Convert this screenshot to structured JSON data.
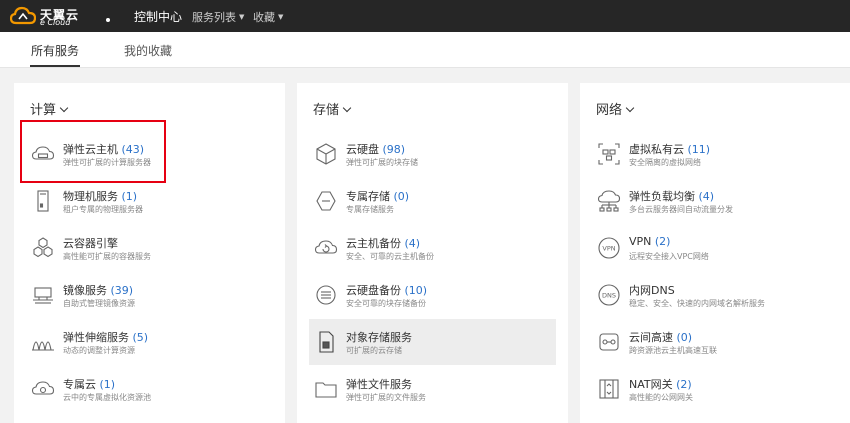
{
  "brand": {
    "name_cn": "天翼云",
    "name_en": "e Cloud"
  },
  "nav": {
    "console": "控制中心",
    "services": "服务列表",
    "favorites": "收藏",
    "caret": "▼"
  },
  "tabs": {
    "all": "所有服务",
    "mine": "我的收藏"
  },
  "columns": [
    {
      "title": "计算",
      "items": [
        {
          "name": "弹性云主机",
          "count": "(43)",
          "desc": "弹性可扩展的计算服务器",
          "icon": "cloud-server-icon"
        },
        {
          "name": "物理机服务",
          "count": "(1)",
          "desc": "租户专属的物理服务器",
          "icon": "physical-server-icon"
        },
        {
          "name": "云容器引擎",
          "count": "",
          "desc": "高性能可扩展的容器服务",
          "icon": "container-engine-icon"
        },
        {
          "name": "镜像服务",
          "count": "(39)",
          "desc": "自助式管理镜像资源",
          "icon": "image-service-icon"
        },
        {
          "name": "弹性伸缩服务",
          "count": "(5)",
          "desc": "动态的调整计算资源",
          "icon": "auto-scaling-icon"
        },
        {
          "name": "专属云",
          "count": "(1)",
          "desc": "云中的专属虚拟化资源池",
          "icon": "dedicated-cloud-icon"
        }
      ]
    },
    {
      "title": "存储",
      "items": [
        {
          "name": "云硬盘",
          "count": "(98)",
          "desc": "弹性可扩展的块存储",
          "icon": "cloud-disk-icon"
        },
        {
          "name": "专属存储",
          "count": "(0)",
          "desc": "专属存储服务",
          "icon": "dedicated-storage-icon"
        },
        {
          "name": "云主机备份",
          "count": "(4)",
          "desc": "安全、可靠的云主机备份",
          "icon": "server-backup-icon"
        },
        {
          "name": "云硬盘备份",
          "count": "(10)",
          "desc": "安全可靠的块存储备份",
          "icon": "disk-backup-icon"
        },
        {
          "name": "对象存储服务",
          "count": "",
          "desc": "可扩展的云存储",
          "icon": "object-storage-icon"
        },
        {
          "name": "弹性文件服务",
          "count": "",
          "desc": "弹性可扩展的文件服务",
          "icon": "file-service-icon"
        }
      ]
    },
    {
      "title": "网络",
      "items": [
        {
          "name": "虚拟私有云",
          "count": "(11)",
          "desc": "安全隔离的虚拟网络",
          "icon": "vpc-icon"
        },
        {
          "name": "弹性负载均衡",
          "count": "(4)",
          "desc": "多台云服务器间自动流量分发",
          "icon": "load-balancer-icon"
        },
        {
          "name": "VPN",
          "count": "(2)",
          "desc": "远程安全接入VPC网络",
          "icon": "vpn-icon"
        },
        {
          "name": "内网DNS",
          "count": "",
          "desc": "稳定、安全、快速的内网域名解析服务",
          "icon": "dns-icon"
        },
        {
          "name": "云间高速",
          "count": "(0)",
          "desc": "跨资源池云主机高速互联",
          "icon": "cloud-connect-icon"
        },
        {
          "name": "NAT网关",
          "count": "(2)",
          "desc": "高性能的公网网关",
          "icon": "nat-gateway-icon"
        }
      ]
    }
  ],
  "colors": {
    "topbar": "#262626",
    "accent_blue": "#2b71c8",
    "highlight_red": "#e60012",
    "brand_orange": "#f39800"
  }
}
